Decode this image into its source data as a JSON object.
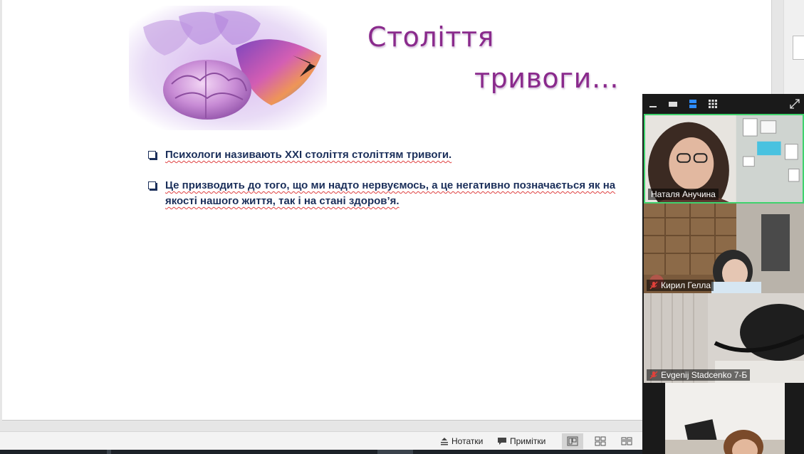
{
  "slide": {
    "title_line1": "Століття",
    "title_line2": "тривоги…",
    "bullets": [
      "Психологи називають XXI століття століттям тривоги.",
      "Це призводить до  того, що ми надто нервуємось, а це негативно позначається як на якості нашого життя, так і на стані здоров’я."
    ]
  },
  "status_bar": {
    "notes_label": "Нотатки",
    "comments_label": "Примітки"
  },
  "zoom": {
    "participants": [
      {
        "name": "Наталя Анучина",
        "muted": false,
        "active": true
      },
      {
        "name": "Кирил Гелла",
        "muted": true,
        "active": false
      },
      {
        "name": "Evgenij Stadcenko 7-Б",
        "muted": true,
        "active": false
      },
      {
        "name": "",
        "muted": false,
        "active": false
      }
    ]
  },
  "colors": {
    "title": "#8a2a8c",
    "bullet_text": "#1b2f5a",
    "active_speaker": "#3fd26d"
  }
}
